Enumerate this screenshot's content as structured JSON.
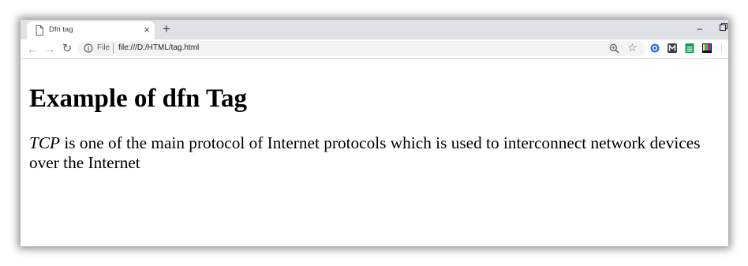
{
  "browser": {
    "tab": {
      "title": "Dfn tag"
    },
    "new_tab_symbol": "+",
    "close_symbol": "×",
    "minimize_symbol": "–",
    "address_bar": {
      "scheme_label": "File",
      "url": "file:///D:/HTML/tag.html"
    },
    "extensions": [
      {
        "icon": "badge-a-icon",
        "color": "#1a73e8"
      },
      {
        "icon": "m-logo-icon",
        "color": "#3c4043"
      },
      {
        "icon": "sheet-icon",
        "color": "#0f9d58"
      },
      {
        "icon": "color-bars-icon",
        "color": "#7b1fa2"
      }
    ]
  },
  "page": {
    "heading": "Example of dfn Tag",
    "paragraph": {
      "term": "TCP",
      "text": " is one of the main protocol of Internet protocols which is used to interconnect network devices over the Internet"
    }
  }
}
